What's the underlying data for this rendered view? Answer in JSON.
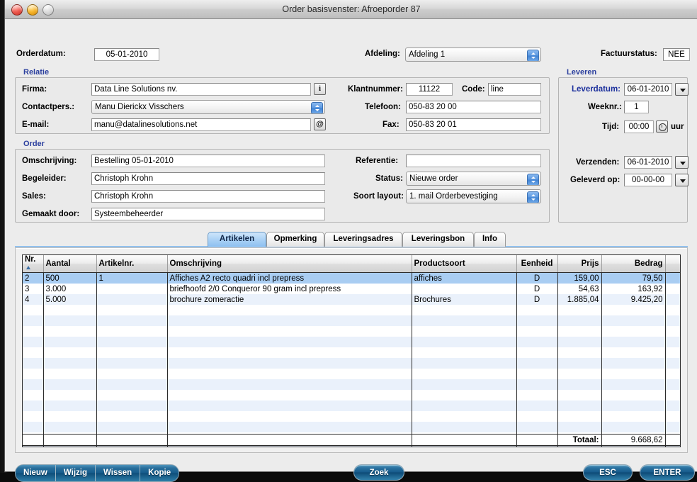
{
  "window": {
    "title": "Order basisvenster: Afroeporder 87",
    "traffic_lights": [
      "close-button",
      "minimize-button",
      "zoom-button"
    ]
  },
  "top_row": {
    "orderdatum_label": "Orderdatum:",
    "orderdatum_value": "05-01-2010",
    "afdeling_label": "Afdeling:",
    "afdeling_value": "Afdeling 1",
    "factuurstatus_label": "Factuurstatus:",
    "factuurstatus_value": "NEE"
  },
  "relatie": {
    "legend": "Relatie",
    "firma_label": "Firma:",
    "firma_value": "Data Line Solutions nv.",
    "firma_info_icon": "i",
    "contactpers_label": "Contactpers.:",
    "contactpers_value": "Manu Dierickx Visschers",
    "email_label": "E-mail:",
    "email_value": "manu@datalinesolutions.net",
    "email_icon": "@",
    "klantnummer_label": "Klantnummer:",
    "klantnummer_value": "11122",
    "code_label": "Code:",
    "code_value": "line",
    "telefoon_label": "Telefoon:",
    "telefoon_value": "050-83 20 00",
    "fax_label": "Fax:",
    "fax_value": "050-83 20 01"
  },
  "order": {
    "legend": "Order",
    "omschrijving_label": "Omschrijving:",
    "omschrijving_value": "Bestelling 05-01-2010",
    "begeleider_label": "Begeleider:",
    "begeleider_value": "Christoph Krohn",
    "sales_label": "Sales:",
    "sales_value": "Christoph Krohn",
    "gemaakt_door_label": "Gemaakt door:",
    "gemaakt_door_value": "Systeembeheerder",
    "referentie_label": "Referentie:",
    "referentie_value": "",
    "status_label": "Status:",
    "status_value": "Nieuwe order",
    "soort_layout_label": "Soort layout:",
    "soort_layout_value": "1. mail Orderbevestiging"
  },
  "leveren": {
    "legend": "Leveren",
    "leverdatum_label": "Leverdatum:",
    "leverdatum_value": "06-01-2010",
    "weeknr_label": "Weeknr.:",
    "weeknr_value": "1",
    "tijd_label": "Tijd:",
    "tijd_value": "00:00",
    "tijd_unit": "uur",
    "verzenden_label": "Verzenden:",
    "verzenden_value": "06-01-2010",
    "geleverd_op_label": "Geleverd op:",
    "geleverd_op_value": "00-00-00"
  },
  "tabs": [
    {
      "label": "Artikelen",
      "active": true
    },
    {
      "label": "Opmerking",
      "active": false
    },
    {
      "label": "Leveringsadres",
      "active": false
    },
    {
      "label": "Leveringsbon",
      "active": false
    },
    {
      "label": "Info",
      "active": false
    }
  ],
  "table": {
    "columns": [
      "Nr.",
      "Aantal",
      "Artikelnr.",
      "Omschrijving",
      "Productsoort",
      "Eenheid",
      "Prijs",
      "Bedrag",
      ""
    ],
    "sort_column": "Nr.",
    "rows": [
      {
        "nr": "2",
        "aantal": "500",
        "artikelnr": "1",
        "omschrijving": "Affiches A2 recto quadri incl prepress",
        "productsoort": "affiches",
        "eenheid": "D",
        "prijs": "159,00",
        "bedrag": "79,50",
        "selected": true
      },
      {
        "nr": "3",
        "aantal": "3.000",
        "artikelnr": "",
        "omschrijving": "briefhoofd 2/0 Conqueror 90 gram incl prepress",
        "productsoort": "",
        "eenheid": "D",
        "prijs": "54,63",
        "bedrag": "163,92",
        "selected": false
      },
      {
        "nr": "4",
        "aantal": "5.000",
        "artikelnr": "",
        "omschrijving": "brochure zomeractie",
        "productsoort": "Brochures",
        "eenheid": "D",
        "prijs": "1.885,04",
        "bedrag": "9.425,20",
        "selected": false
      }
    ],
    "total_label": "Totaal:",
    "total_value": "9.668,62"
  },
  "footer": {
    "left_buttons": [
      "Nieuw",
      "Wijzig",
      "Wissen",
      "Kopie"
    ],
    "center_button": "Zoek",
    "esc_button": "ESC",
    "enter_button": "ENTER"
  },
  "colors": {
    "legend": "#2b3f9e",
    "selection": "#a9cdf2",
    "alt_row": "#eaf1fb",
    "button": "#14598a",
    "tab_active": "#a8d0f5"
  }
}
